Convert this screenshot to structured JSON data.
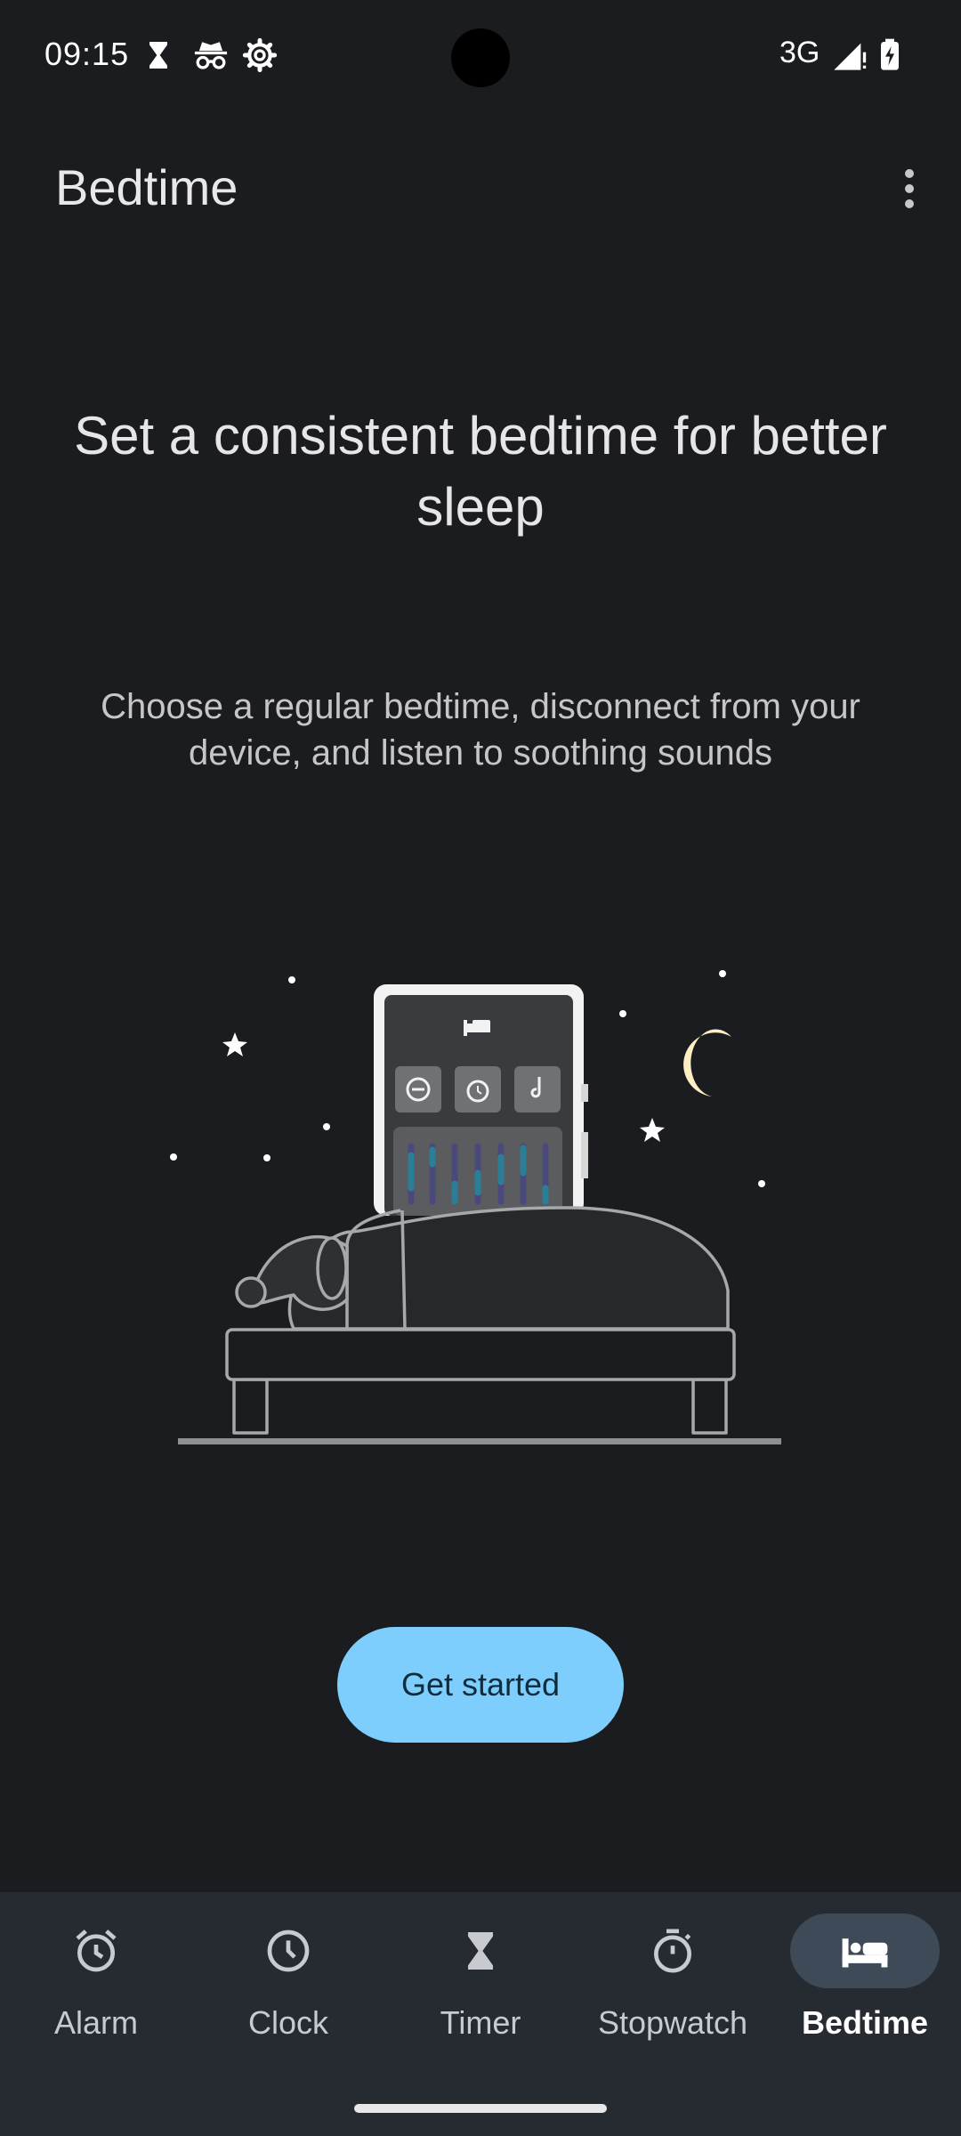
{
  "status_bar": {
    "time": "09:15",
    "network": "3G",
    "icons": [
      "hourglass-icon",
      "incognito-icon",
      "settings-gear-icon",
      "signal-icon",
      "battery-charging-icon"
    ]
  },
  "app_bar": {
    "title": "Bedtime",
    "overflow_icon": "more-vert-icon"
  },
  "content": {
    "headline": "Set a consistent bedtime for better sleep",
    "description": "Choose a regular bedtime, disconnect from your device, and listen to soothing sounds",
    "cta_label": "Get started"
  },
  "colors": {
    "background": "#1b1c1f",
    "accent": "#7dcefc",
    "nav_background": "#262a31",
    "active_indicator": "#3e4a57",
    "moon": "#fdefc3"
  },
  "bottom_nav": {
    "items": [
      {
        "label": "Alarm",
        "icon": "alarm-icon",
        "active": false
      },
      {
        "label": "Clock",
        "icon": "clock-icon",
        "active": false
      },
      {
        "label": "Timer",
        "icon": "hourglass-icon",
        "active": false
      },
      {
        "label": "Stopwatch",
        "icon": "stopwatch-icon",
        "active": false
      },
      {
        "label": "Bedtime",
        "icon": "bed-icon",
        "active": true
      }
    ]
  }
}
